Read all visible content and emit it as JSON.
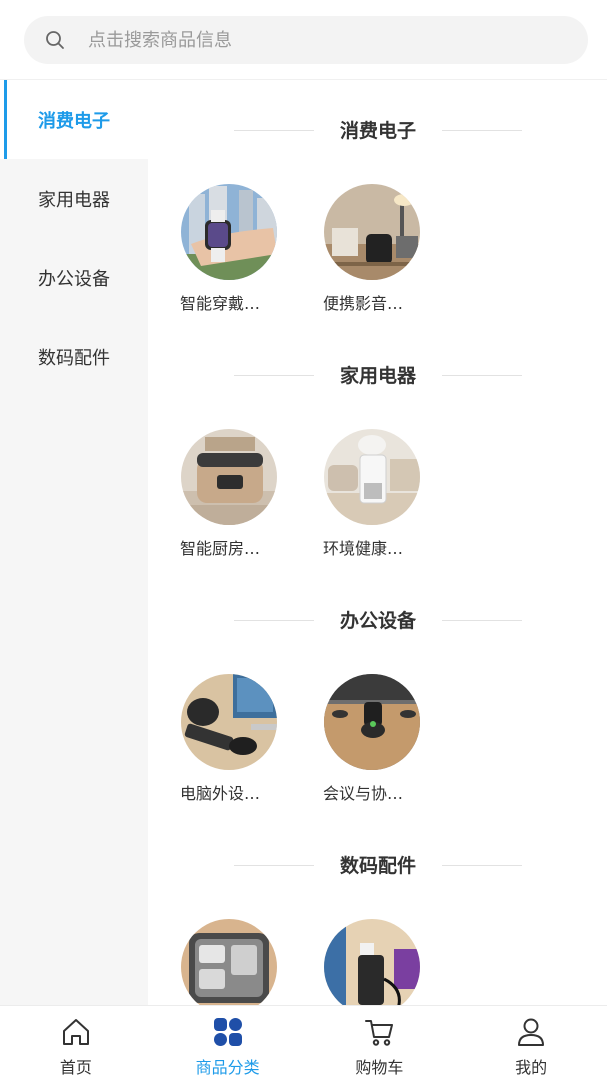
{
  "search": {
    "placeholder": "点击搜索商品信息"
  },
  "sidebar": {
    "items": [
      {
        "label": "消费电子",
        "active": true
      },
      {
        "label": "家用电器",
        "active": false
      },
      {
        "label": "办公设备",
        "active": false
      },
      {
        "label": "数码配件",
        "active": false
      }
    ]
  },
  "sections": [
    {
      "title": "消费电子",
      "products": [
        {
          "label": "智能穿戴…"
        },
        {
          "label": "便携影音…"
        }
      ]
    },
    {
      "title": "家用电器",
      "products": [
        {
          "label": "智能厨房…"
        },
        {
          "label": "环境健康…"
        }
      ]
    },
    {
      "title": "办公设备",
      "products": [
        {
          "label": "电脑外设…"
        },
        {
          "label": "会议与协…"
        }
      ]
    },
    {
      "title": "数码配件",
      "products": [
        {
          "label": ""
        },
        {
          "label": ""
        }
      ]
    }
  ],
  "tabbar": {
    "items": [
      {
        "label": "首页",
        "icon": "home-icon"
      },
      {
        "label": "商品分类",
        "icon": "category-icon",
        "active": true
      },
      {
        "label": "购物车",
        "icon": "cart-icon"
      },
      {
        "label": "我的",
        "icon": "user-icon"
      }
    ]
  },
  "colors": {
    "accent": "#1e9be9",
    "sidebar_bg": "#f6f6f6",
    "search_bg": "#f3f3f3"
  }
}
